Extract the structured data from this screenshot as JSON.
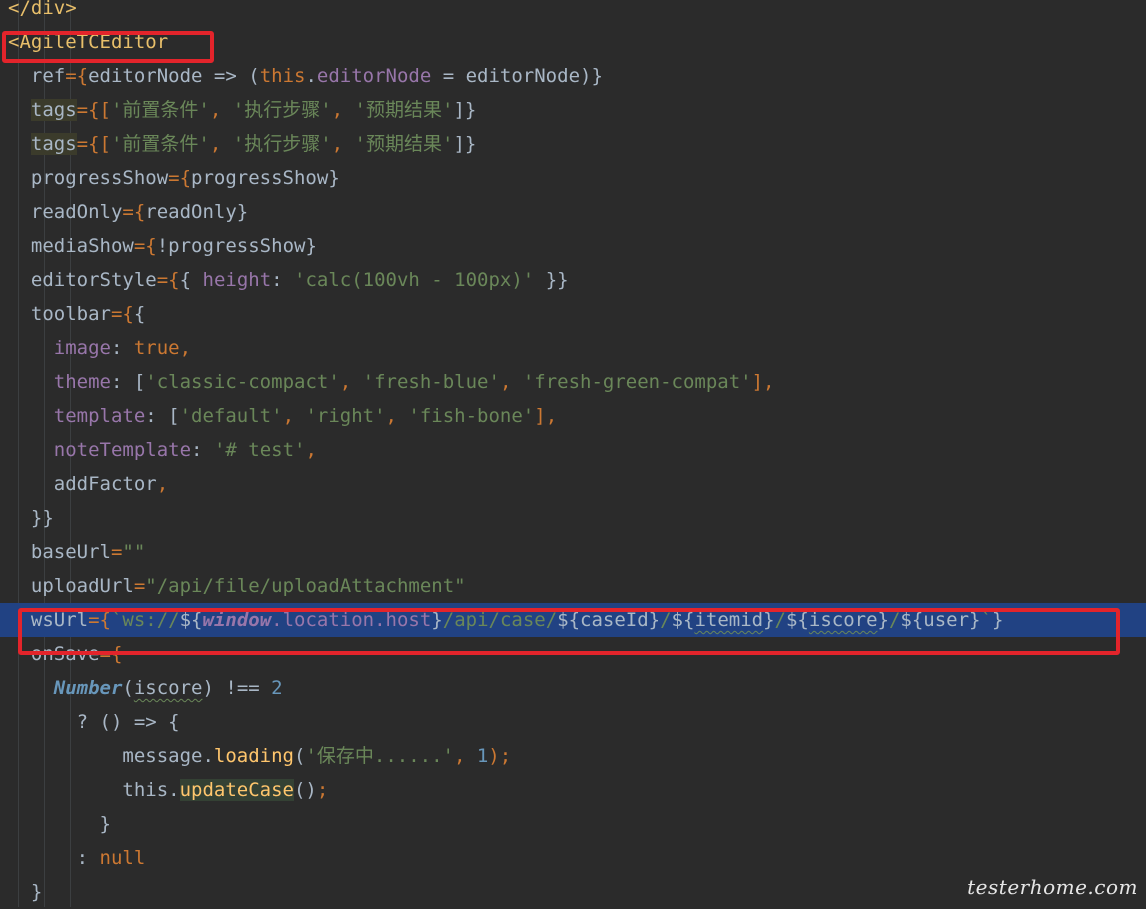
{
  "editor": {
    "lines": [
      {
        "tokens": [
          {
            "t": "</div>",
            "c": "t-tag"
          }
        ]
      },
      {
        "tokens": [
          {
            "t": "<AgileTCEditor",
            "c": "t-tag"
          }
        ]
      },
      {
        "tokens": [
          {
            "t": "  ref",
            "c": "t-attr"
          },
          {
            "t": "={",
            "c": "t-punct"
          },
          {
            "t": "editorNode => (",
            "c": "t-plain"
          },
          {
            "t": "this",
            "c": "t-kw"
          },
          {
            "t": ".",
            "c": "t-plain"
          },
          {
            "t": "editorNode",
            "c": "t-prop"
          },
          {
            "t": " = editorNode)}",
            "c": "t-plain"
          }
        ]
      },
      {
        "tokens": [
          {
            "t": "  ",
            "c": "t-plain"
          },
          {
            "t": "tags",
            "c": "t-attr",
            "x": "hl-attr"
          },
          {
            "t": "={[",
            "c": "t-punct"
          },
          {
            "t": "'前置条件'",
            "c": "t-str"
          },
          {
            "t": ", ",
            "c": "t-punct"
          },
          {
            "t": "'执行步骤'",
            "c": "t-str"
          },
          {
            "t": ", ",
            "c": "t-punct"
          },
          {
            "t": "'预期结果'",
            "c": "t-str"
          },
          {
            "t": "]}",
            "c": "t-plain"
          }
        ]
      },
      {
        "tokens": [
          {
            "t": "  ",
            "c": "t-plain"
          },
          {
            "t": "tags",
            "c": "t-attr",
            "x": "hl-attr"
          },
          {
            "t": "={[",
            "c": "t-punct"
          },
          {
            "t": "'前置条件'",
            "c": "t-str"
          },
          {
            "t": ", ",
            "c": "t-punct"
          },
          {
            "t": "'执行步骤'",
            "c": "t-str"
          },
          {
            "t": ", ",
            "c": "t-punct"
          },
          {
            "t": "'预期结果'",
            "c": "t-str"
          },
          {
            "t": "]}",
            "c": "t-plain"
          }
        ]
      },
      {
        "tokens": [
          {
            "t": "  progressShow",
            "c": "t-attr"
          },
          {
            "t": "={",
            "c": "t-punct"
          },
          {
            "t": "progressShow}",
            "c": "t-plain"
          }
        ]
      },
      {
        "tokens": [
          {
            "t": "  readOnly",
            "c": "t-attr"
          },
          {
            "t": "={",
            "c": "t-punct"
          },
          {
            "t": "readOnly}",
            "c": "t-plain"
          }
        ]
      },
      {
        "tokens": [
          {
            "t": "  mediaShow",
            "c": "t-attr"
          },
          {
            "t": "={",
            "c": "t-punct"
          },
          {
            "t": "!progressShow}",
            "c": "t-plain"
          }
        ]
      },
      {
        "tokens": [
          {
            "t": "  editorStyle",
            "c": "t-attr"
          },
          {
            "t": "={",
            "c": "t-punct"
          },
          {
            "t": "{ ",
            "c": "t-plain"
          },
          {
            "t": "height",
            "c": "t-prop"
          },
          {
            "t": ": ",
            "c": "t-plain"
          },
          {
            "t": "'calc(100vh - 100px)'",
            "c": "t-str"
          },
          {
            "t": " }}",
            "c": "t-plain"
          }
        ]
      },
      {
        "tokens": [
          {
            "t": "  toolbar",
            "c": "t-attr"
          },
          {
            "t": "={",
            "c": "t-punct"
          },
          {
            "t": "{",
            "c": "t-plain"
          }
        ]
      },
      {
        "tokens": [
          {
            "t": "    ",
            "c": "t-plain"
          },
          {
            "t": "image",
            "c": "t-prop"
          },
          {
            "t": ": ",
            "c": "t-plain"
          },
          {
            "t": "true",
            "c": "t-kw"
          },
          {
            "t": ",",
            "c": "t-punct"
          }
        ]
      },
      {
        "tokens": [
          {
            "t": "    ",
            "c": "t-plain"
          },
          {
            "t": "theme",
            "c": "t-prop"
          },
          {
            "t": ": [",
            "c": "t-plain"
          },
          {
            "t": "'classic-compact'",
            "c": "t-str"
          },
          {
            "t": ", ",
            "c": "t-punct"
          },
          {
            "t": "'fresh-blue'",
            "c": "t-str"
          },
          {
            "t": ", ",
            "c": "t-punct"
          },
          {
            "t": "'fresh-green-compat'",
            "c": "t-str"
          },
          {
            "t": "],",
            "c": "t-punct"
          }
        ]
      },
      {
        "tokens": [
          {
            "t": "    ",
            "c": "t-plain"
          },
          {
            "t": "template",
            "c": "t-prop"
          },
          {
            "t": ": [",
            "c": "t-plain"
          },
          {
            "t": "'default'",
            "c": "t-str"
          },
          {
            "t": ", ",
            "c": "t-punct"
          },
          {
            "t": "'right'",
            "c": "t-str"
          },
          {
            "t": ", ",
            "c": "t-punct"
          },
          {
            "t": "'fish-bone'",
            "c": "t-str"
          },
          {
            "t": "],",
            "c": "t-punct"
          }
        ]
      },
      {
        "tokens": [
          {
            "t": "    ",
            "c": "t-plain"
          },
          {
            "t": "noteTemplate",
            "c": "t-prop"
          },
          {
            "t": ": ",
            "c": "t-plain"
          },
          {
            "t": "'# test'",
            "c": "t-str"
          },
          {
            "t": ",",
            "c": "t-punct"
          }
        ]
      },
      {
        "tokens": [
          {
            "t": "    addFactor",
            "c": "t-plain"
          },
          {
            "t": ",",
            "c": "t-punct"
          }
        ]
      },
      {
        "tokens": [
          {
            "t": "  }}",
            "c": "t-plain"
          }
        ]
      },
      {
        "tokens": [
          {
            "t": "  baseUrl",
            "c": "t-attr"
          },
          {
            "t": "=",
            "c": "t-punct"
          },
          {
            "t": "\"\"",
            "c": "t-str"
          }
        ]
      },
      {
        "tokens": [
          {
            "t": "  uploadUrl",
            "c": "t-attr"
          },
          {
            "t": "=",
            "c": "t-punct"
          },
          {
            "t": "\"/api/file/uploadAttachment\"",
            "c": "t-str"
          }
        ]
      },
      {
        "selected": true,
        "tokens": [
          {
            "t": "  wsUrl",
            "c": "t-attr"
          },
          {
            "t": "={",
            "c": "t-punct"
          },
          {
            "t": "`ws://",
            "c": "t-str"
          },
          {
            "t": "${",
            "c": "t-plain"
          },
          {
            "t": "window",
            "c": "t-italic"
          },
          {
            "t": ".location.host",
            "c": "t-prop"
          },
          {
            "t": "}",
            "c": "t-plain"
          },
          {
            "t": "/api/case/",
            "c": "t-str"
          },
          {
            "t": "${caseId}",
            "c": "t-plain"
          },
          {
            "t": "/",
            "c": "t-str"
          },
          {
            "t": "${",
            "c": "t-plain"
          },
          {
            "t": "itemid",
            "c": "t-plain",
            "x": "squiggle"
          },
          {
            "t": "}",
            "c": "t-plain"
          },
          {
            "t": "/",
            "c": "t-str"
          },
          {
            "t": "${",
            "c": "t-plain"
          },
          {
            "t": "iscore",
            "c": "t-plain",
            "x": "squiggle"
          },
          {
            "t": "}",
            "c": "t-plain"
          },
          {
            "t": "/",
            "c": "t-str"
          },
          {
            "t": "${user}",
            "c": "t-plain"
          },
          {
            "t": "`",
            "c": "t-str"
          },
          {
            "t": "}",
            "c": "t-plain"
          }
        ]
      },
      {
        "tokens": [
          {
            "t": "  onSave",
            "c": "t-attr"
          },
          {
            "t": "={",
            "c": "t-punct"
          }
        ]
      },
      {
        "tokens": [
          {
            "t": "    ",
            "c": "t-plain"
          },
          {
            "t": "Number",
            "c": "t-class"
          },
          {
            "t": "(",
            "c": "t-plain"
          },
          {
            "t": "iscore",
            "c": "t-plain",
            "x": "squiggle"
          },
          {
            "t": ") !== ",
            "c": "t-plain"
          },
          {
            "t": "2",
            "c": "t-num"
          }
        ]
      },
      {
        "tokens": [
          {
            "t": "      ? () => {",
            "c": "t-plain"
          }
        ]
      },
      {
        "tokens": [
          {
            "t": "          message.",
            "c": "t-plain"
          },
          {
            "t": "loading",
            "c": "t-fn"
          },
          {
            "t": "(",
            "c": "t-plain"
          },
          {
            "t": "'保存中......'",
            "c": "t-str"
          },
          {
            "t": ", ",
            "c": "t-punct"
          },
          {
            "t": "1",
            "c": "t-num"
          },
          {
            "t": ");",
            "c": "t-punct"
          }
        ]
      },
      {
        "tokens": [
          {
            "t": "          this.",
            "c": "t-plain"
          },
          {
            "t": "updateCase",
            "c": "t-fn",
            "x": "hl-green"
          },
          {
            "t": "()",
            "c": "t-plain"
          },
          {
            "t": ";",
            "c": "t-punct"
          }
        ]
      },
      {
        "tokens": [
          {
            "t": "        }",
            "c": "t-plain"
          }
        ]
      },
      {
        "tokens": [
          {
            "t": "      : ",
            "c": "t-plain"
          },
          {
            "t": "null",
            "c": "t-kw"
          }
        ]
      },
      {
        "tokens": [
          {
            "t": "  }",
            "c": "t-plain"
          }
        ]
      }
    ]
  },
  "watermark": "testerhome.com",
  "colors": {
    "background": "#2b2b2b",
    "selection": "#214283",
    "annotation": "#e3242b"
  }
}
